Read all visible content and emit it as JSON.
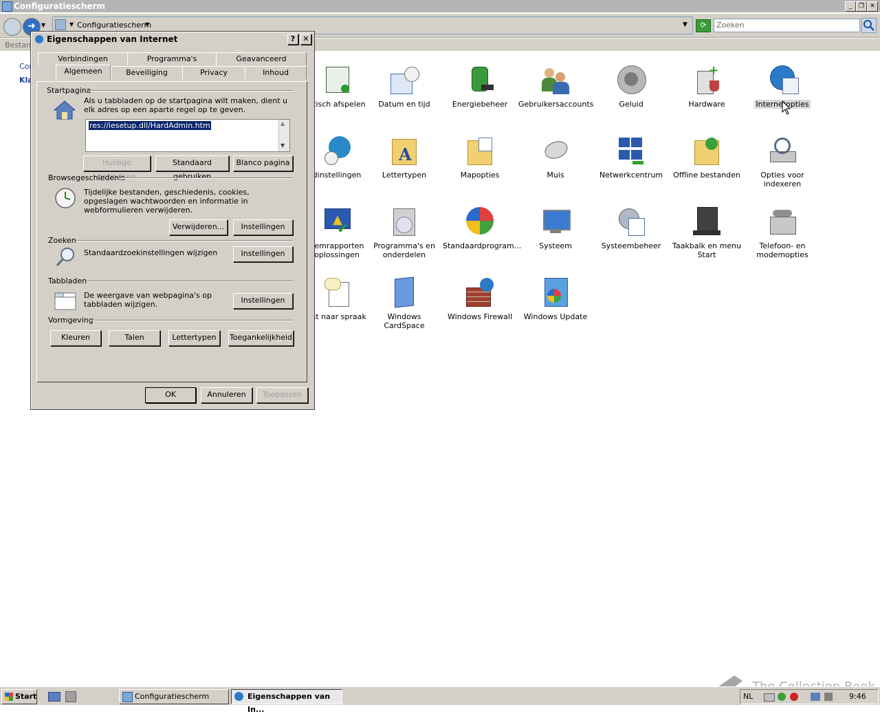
{
  "window": {
    "title": "Configuratiescherm",
    "address_crumb": "Configuratiescherm",
    "search_placeholder": "Zoeken",
    "menu_partial": "Bestand",
    "sidebar_partial_1": "Cor",
    "sidebar_partial_2": "Kla"
  },
  "items": [
    {
      "label": "atisch afspelen",
      "icon": "autoplay-icon"
    },
    {
      "label": "Datum en tijd",
      "icon": "calendar-clock-icon"
    },
    {
      "label": "Energiebeheer",
      "icon": "battery-plug-icon"
    },
    {
      "label": "Gebruikersaccounts",
      "icon": "users-icon"
    },
    {
      "label": "Geluid",
      "icon": "speaker-icon"
    },
    {
      "label": "Hardware",
      "icon": "hardware-icon"
    },
    {
      "label": "Internetopties",
      "icon": "globe-icon"
    },
    {
      "label": "dinstellingen",
      "icon": "globe-clock-icon"
    },
    {
      "label": "Lettertypen",
      "icon": "font-folder-icon"
    },
    {
      "label": "Mapopties",
      "icon": "folder-options-icon"
    },
    {
      "label": "Muis",
      "icon": "mouse-icon"
    },
    {
      "label": "Netwerkcentrum",
      "icon": "network-icon"
    },
    {
      "label": "Offline bestanden",
      "icon": "offline-folder-icon"
    },
    {
      "label": "Opties voor indexeren",
      "icon": "index-search-icon"
    },
    {
      "label": "eemrapporten oplossingen",
      "icon": "problem-reports-icon"
    },
    {
      "label": "Programma's en onderdelen",
      "icon": "programs-icon"
    },
    {
      "label": "Standaardprogram...",
      "icon": "default-programs-icon"
    },
    {
      "label": "Systeem",
      "icon": "computer-icon"
    },
    {
      "label": "Systeembeheer",
      "icon": "admin-tools-icon"
    },
    {
      "label": "Taakbalk en menu Start",
      "icon": "taskbar-icon"
    },
    {
      "label": "Telefoon- en modemopties",
      "icon": "phone-icon"
    },
    {
      "label": "kst naar spraak",
      "icon": "speech-icon"
    },
    {
      "label": "Windows CardSpace",
      "icon": "cardspace-icon"
    },
    {
      "label": "Windows Firewall",
      "icon": "firewall-icon"
    },
    {
      "label": "Windows Update",
      "icon": "update-icon"
    }
  ],
  "dialog": {
    "title": "Eigenschappen van Internet",
    "help": "?",
    "close": "✕",
    "tabs_row1": [
      "Verbindingen",
      "Programma's",
      "Geavanceerd"
    ],
    "tabs_row2": [
      "Algemeen",
      "Beveiliging",
      "Privacy",
      "Inhoud"
    ],
    "startpagina": {
      "label": "Startpagina",
      "desc": "Als u tabbladen op de startpagina wilt maken, dient u elk adres op een aparte regel op te geven.",
      "value": "res://iesetup.dll/HardAdmin.htm",
      "btn_current": "Huidige gebruiken",
      "btn_default": "Standaard gebruiken",
      "btn_blank": "Blanco pagina"
    },
    "browse": {
      "label": "Browsegeschiedenis",
      "desc": "Tijdelijke bestanden, geschiedenis, cookies, opgeslagen wachtwoorden en informatie in webformulieren verwijderen.",
      "btn_delete": "Verwijderen...",
      "btn_settings": "Instellingen"
    },
    "search": {
      "label": "Zoeken",
      "desc": "Standaardzoekinstellingen wijzigen",
      "btn_settings": "Instellingen"
    },
    "tabs_section": {
      "label": "Tabbladen",
      "desc": "De weergave van webpagina's op tabbladen wijzigen.",
      "btn_settings": "Instellingen"
    },
    "appearance": {
      "label": "Vormgeving",
      "btn_colors": "Kleuren",
      "btn_languages": "Talen",
      "btn_fonts": "Lettertypen",
      "btn_accessibility": "Toegankelijkheid"
    },
    "ok": "OK",
    "cancel": "Annuleren",
    "apply": "Toepassen"
  },
  "taskbar": {
    "start": "Start",
    "task1": "Configuratiescherm",
    "task2": "Eigenschappen van In...",
    "lang": "NL",
    "clock": "9:46"
  },
  "watermark": "The Collection Book",
  "colors": {
    "selection": "#0a246a",
    "title_inactive": "#b5b5b5",
    "face": "#d4d0c8"
  }
}
